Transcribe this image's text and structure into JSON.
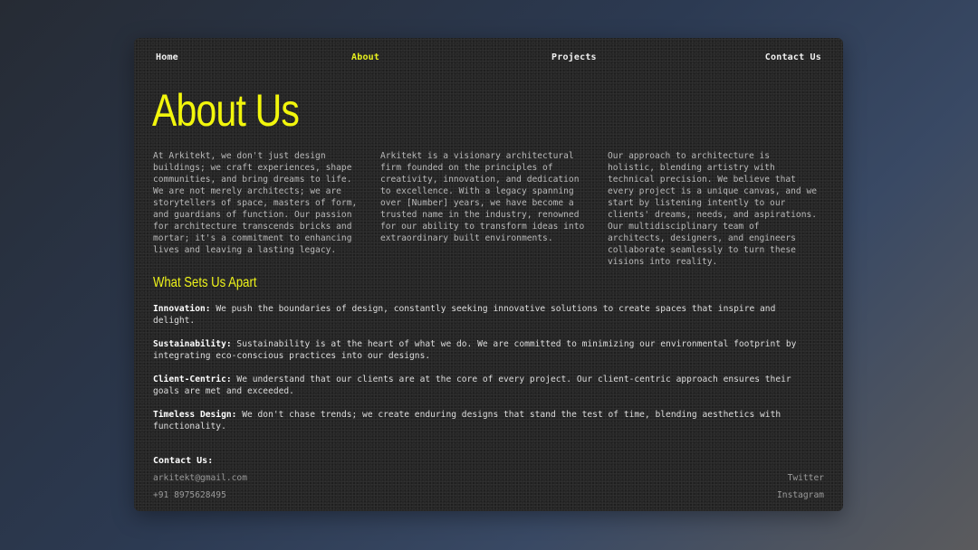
{
  "nav": {
    "home": "Home",
    "about": "About",
    "projects": "Projects",
    "contact": "Contact Us"
  },
  "page": {
    "title": "About Us",
    "columns": [
      "At Arkitekt, we don't just design buildings; we craft experiences, shape communities, and bring dreams to life. We are not merely architects; we are storytellers of space, masters of form, and guardians of function. Our passion for architecture transcends bricks and mortar; it's a commitment to enhancing lives and leaving a lasting legacy.",
      "Arkitekt is a visionary architectural firm founded on the principles of creativity, innovation, and dedication to excellence. With a legacy spanning over [Number] years, we have become a trusted name in the industry, renowned for our ability to transform ideas into extraordinary built environments.",
      "Our approach to architecture is holistic, blending artistry with technical precision. We believe that every project is a unique canvas, and we start by listening intently to our clients' dreams, needs, and aspirations. Our multidisciplinary team of architects, designers, and engineers collaborate seamlessly to turn these visions into reality."
    ],
    "subheading": "What Sets Us Apart",
    "features": [
      {
        "label": "Innovation:",
        "text": " We push the boundaries of design, constantly seeking innovative solutions to create spaces that inspire and delight."
      },
      {
        "label": "Sustainability:",
        "text": " Sustainability is at the heart of what we do. We are committed to minimizing our environmental footprint by integrating eco-conscious practices into our designs."
      },
      {
        "label": "Client-Centric:",
        "text": " We understand that our clients are at the core of every project. Our client-centric approach ensures their goals are met and exceeded."
      },
      {
        "label": "Timeless Design:",
        "text": " We don't chase trends; we create enduring designs that stand the test of time, blending aesthetics with functionality."
      }
    ]
  },
  "contact": {
    "title": "Contact Us:",
    "email": "arkitekt@gmail.com",
    "phone": "+91 8975628495",
    "twitter": "Twitter",
    "instagram": "Instagram"
  },
  "colors": {
    "accent": "#e9f21f",
    "card_bg": "#262626",
    "body_text": "#b9b9b9"
  }
}
